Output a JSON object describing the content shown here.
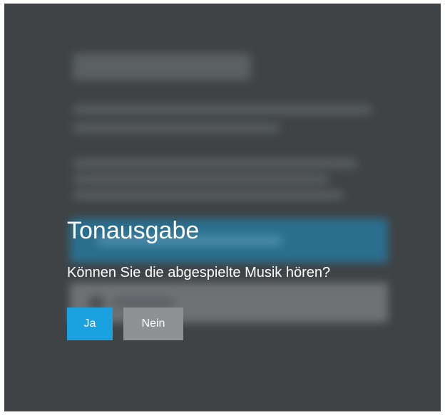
{
  "dialog": {
    "title": "Tonausgabe",
    "question": "Können Sie die abgespielte Musik hören?",
    "yes_label": "Ja",
    "no_label": "Nein"
  },
  "colors": {
    "screen_background": "#3f4345",
    "yes_button": "#1aa1e0",
    "no_button": "#8f9294",
    "text": "#ffffff"
  }
}
